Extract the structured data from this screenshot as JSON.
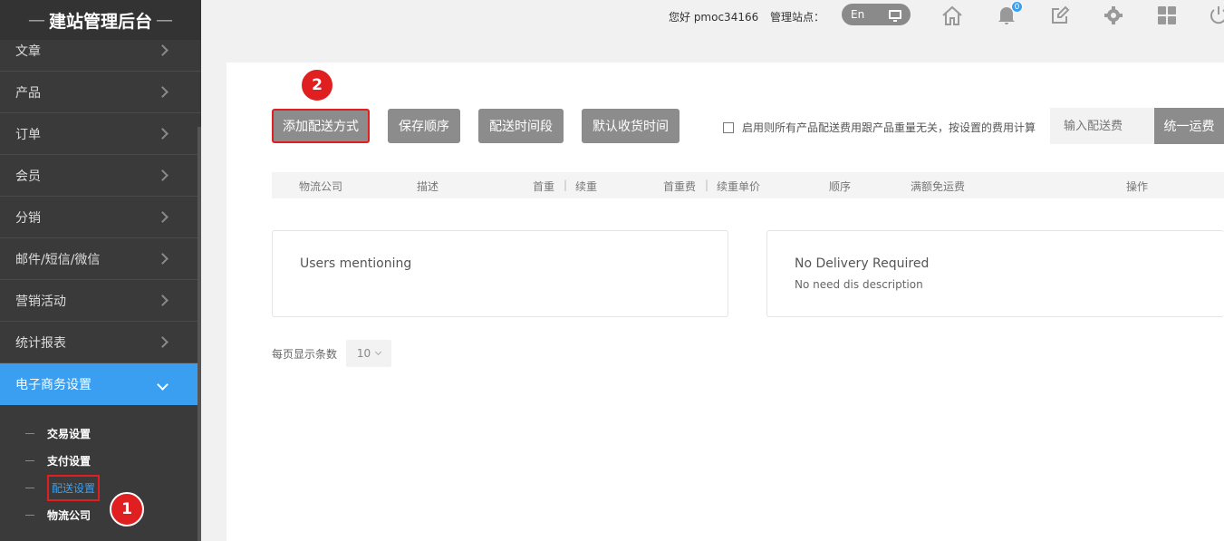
{
  "sidebar": {
    "logo_text": "建站管理后台",
    "logo_dash": "—",
    "items": [
      {
        "label": "文章"
      },
      {
        "label": "产品"
      },
      {
        "label": "订单"
      },
      {
        "label": "会员"
      },
      {
        "label": "分销"
      },
      {
        "label": "邮件/短信/微信"
      },
      {
        "label": "营销活动"
      },
      {
        "label": "统计报表"
      },
      {
        "label": "电子商务设置"
      }
    ],
    "subitems": [
      {
        "label": "交易设置"
      },
      {
        "label": "支付设置"
      },
      {
        "label": "配送设置"
      },
      {
        "label": "物流公司"
      }
    ]
  },
  "topbar": {
    "greeting": "您好 pmoc34166",
    "site_label": "管理站点：",
    "lang": "En",
    "notification_count": "0"
  },
  "toolbar": {
    "add_method": "添加配送方式",
    "save_order": "保存顺序",
    "time_slot": "配送时间段",
    "default_time": "默认收货时间",
    "checkbox_label": "启用则所有产品配送费用跟产品重量无关，按设置的费用计算",
    "fee_placeholder": "输入配送费",
    "unified_fee": "统一运费"
  },
  "table": {
    "headers": [
      "物流公司",
      "描述",
      "首重",
      "续重",
      "首重费",
      "续重单价",
      "顺序",
      "满额免运费",
      "操作"
    ]
  },
  "cards": [
    {
      "title": "Users mentioning",
      "desc": ""
    },
    {
      "title": "No Delivery Required",
      "desc": "No need dis description"
    }
  ],
  "pager": {
    "label": "每页显示条数",
    "size": "10"
  },
  "annotations": {
    "marker1": "1",
    "marker2": "2"
  },
  "colors": {
    "accent": "#3a9ff0",
    "highlight": "#e02020",
    "button": "#8c8c8c"
  }
}
